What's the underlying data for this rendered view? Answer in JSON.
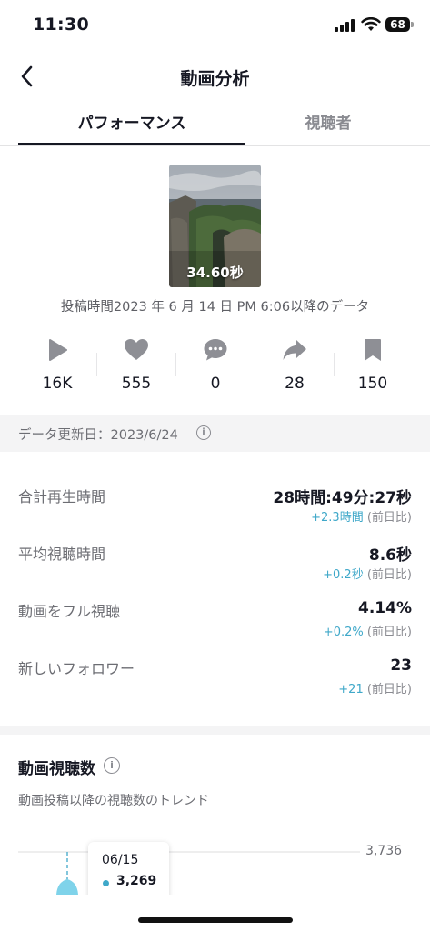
{
  "status_bar": {
    "time": "11:30",
    "battery": "68",
    "icons": [
      "signal-icon",
      "wifi-icon",
      "battery-icon"
    ]
  },
  "header": {
    "title": "動画分析",
    "back_icon": "chevron-left-icon"
  },
  "tabs": [
    {
      "label": "パフォーマンス",
      "active": true
    },
    {
      "label": "視聴者",
      "active": false
    }
  ],
  "video": {
    "duration": "34.60秒",
    "post_info": "投稿時間2023 年 6 月 14 日 PM 6:06以降のデータ"
  },
  "stats": [
    {
      "icon": "play-icon",
      "value": "16K"
    },
    {
      "icon": "heart-icon",
      "value": "555"
    },
    {
      "icon": "comment-icon",
      "value": "0"
    },
    {
      "icon": "share-icon",
      "value": "28"
    },
    {
      "icon": "bookmark-icon",
      "value": "150"
    }
  ],
  "update": {
    "text": "データ更新日：2023/6/24",
    "icon": "info-icon"
  },
  "metrics": [
    {
      "label": "合計再生時間",
      "value": "28時間:49分:27秒",
      "delta": "+2.3時間",
      "note": " (前日比)"
    },
    {
      "label": "平均視聴時間",
      "value": "8.6秒",
      "delta": "+0.2秒",
      "note": " (前日比)"
    },
    {
      "label": "動画をフル視聴",
      "value": "4.14%",
      "delta": "+0.2%",
      "note": " (前日比)"
    },
    {
      "label": "新しいフォロワー",
      "value": "23",
      "delta": "+21",
      "note": " (前日比)"
    }
  ],
  "views": {
    "title": "動画視聴数",
    "subtitle": "動画投稿以降の視聴数のトレンド",
    "y_max_label": "3,736",
    "tooltip": {
      "date": "06/15",
      "value": "3,269"
    }
  },
  "colors": {
    "accent": "#3fa8c9",
    "text_primary": "#161823",
    "text_secondary": "#6c6d73",
    "band": "#f4f4f5"
  },
  "chart_data": {
    "type": "line",
    "ylim": [
      0,
      3736
    ],
    "y_ticks": [
      "3,736"
    ],
    "highlight": {
      "x": "06/15",
      "y": 3269
    }
  }
}
